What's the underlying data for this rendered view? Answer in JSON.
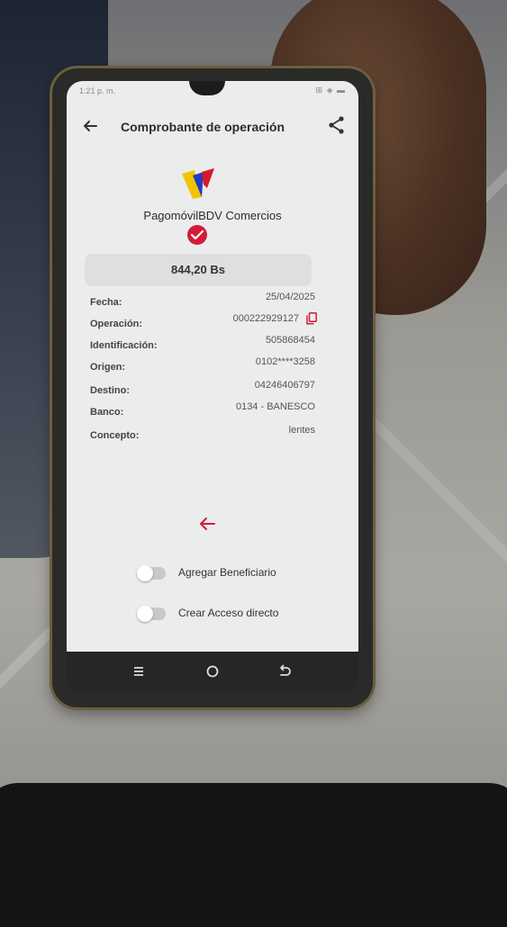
{
  "status_bar": {
    "time": "1:21 p. m.",
    "icons": "⊞ ◈ ▬"
  },
  "header": {
    "title": "Comprobante de operación",
    "back_icon": "arrow-left-icon",
    "share_icon": "share-icon"
  },
  "brand": {
    "name": "PagomóvilBDV Comercios",
    "logo_colors": [
      "#f2c500",
      "#1f3fbf",
      "#d6192c"
    ],
    "accent": "#d21c3a"
  },
  "amount": "844,20 Bs",
  "details": [
    {
      "label": "Fecha:",
      "value": "25/04/2025"
    },
    {
      "label": "Operación:",
      "value": "000222929127"
    },
    {
      "label": "Identificación:",
      "value": "505868454"
    },
    {
      "label": "Origen:",
      "value": "0102****3258"
    },
    {
      "label": "Destino:",
      "value": "04246406797"
    },
    {
      "label": "Banco:",
      "value": "0134 - BANESCO"
    },
    {
      "label": "Concepto:",
      "value": "lentes"
    }
  ],
  "toggles": [
    {
      "label": "Agregar Beneficiario",
      "on": false
    },
    {
      "label": "Crear Acceso directo",
      "on": false
    }
  ],
  "nav": {
    "recents_icon": "recents-icon",
    "home_icon": "home-icon",
    "back_icon": "back-icon"
  }
}
